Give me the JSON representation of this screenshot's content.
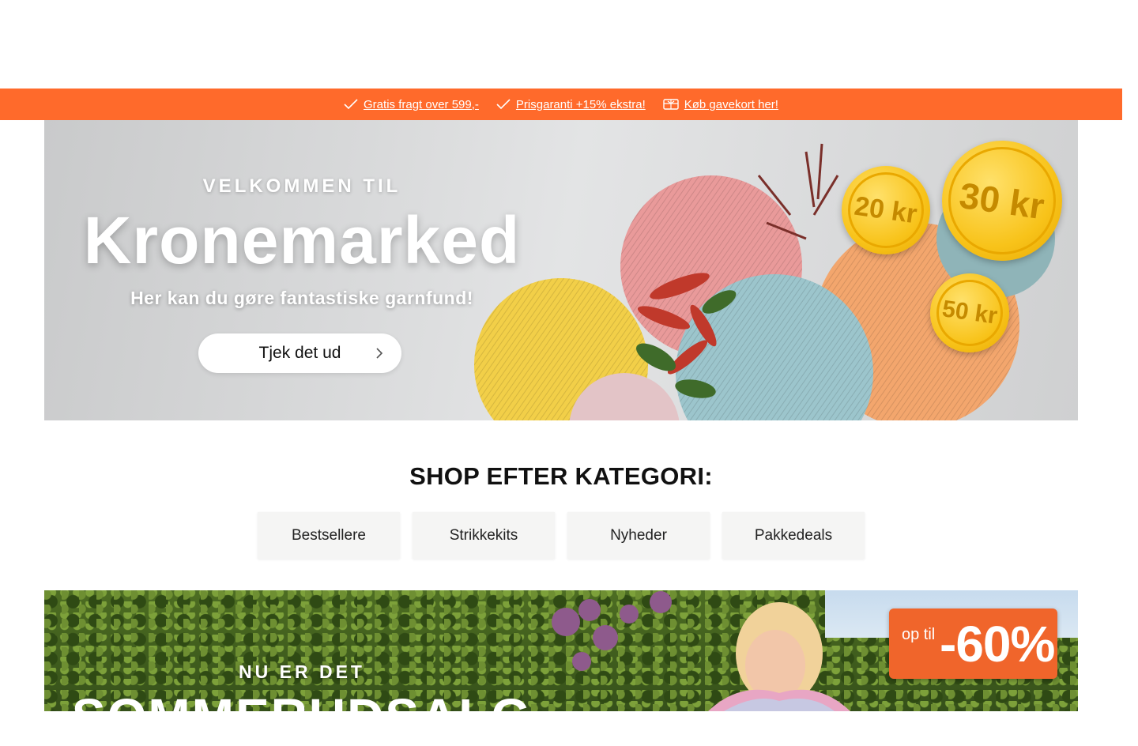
{
  "usp_bar": {
    "items": [
      {
        "icon": "check-icon",
        "label": "Gratis fragt over 599,-"
      },
      {
        "icon": "check-icon",
        "label": "Prisgaranti +15% ekstra!"
      },
      {
        "icon": "gift-card-icon",
        "label": "Køb gavekort her!"
      }
    ],
    "background": "#ff6a2b"
  },
  "hero": {
    "eyebrow": "VELKOMMEN TIL",
    "title": "Kronemarked",
    "subtitle": "Her kan du gøre fantastiske garnfund!",
    "cta_label": "Tjek det ud",
    "coins": [
      "20 kr",
      "30 kr",
      "50 kr"
    ]
  },
  "categories": {
    "title": "SHOP EFTER KATEGORI:",
    "items": [
      "Bestsellere",
      "Strikkekits",
      "Nyheder",
      "Pakkedeals"
    ]
  },
  "banner2": {
    "eyebrow": "NU ER DET",
    "title": "SOMMERUDSALG",
    "discount_prefix": "op til",
    "discount_value": "-60%",
    "accent": "#f0652b"
  }
}
